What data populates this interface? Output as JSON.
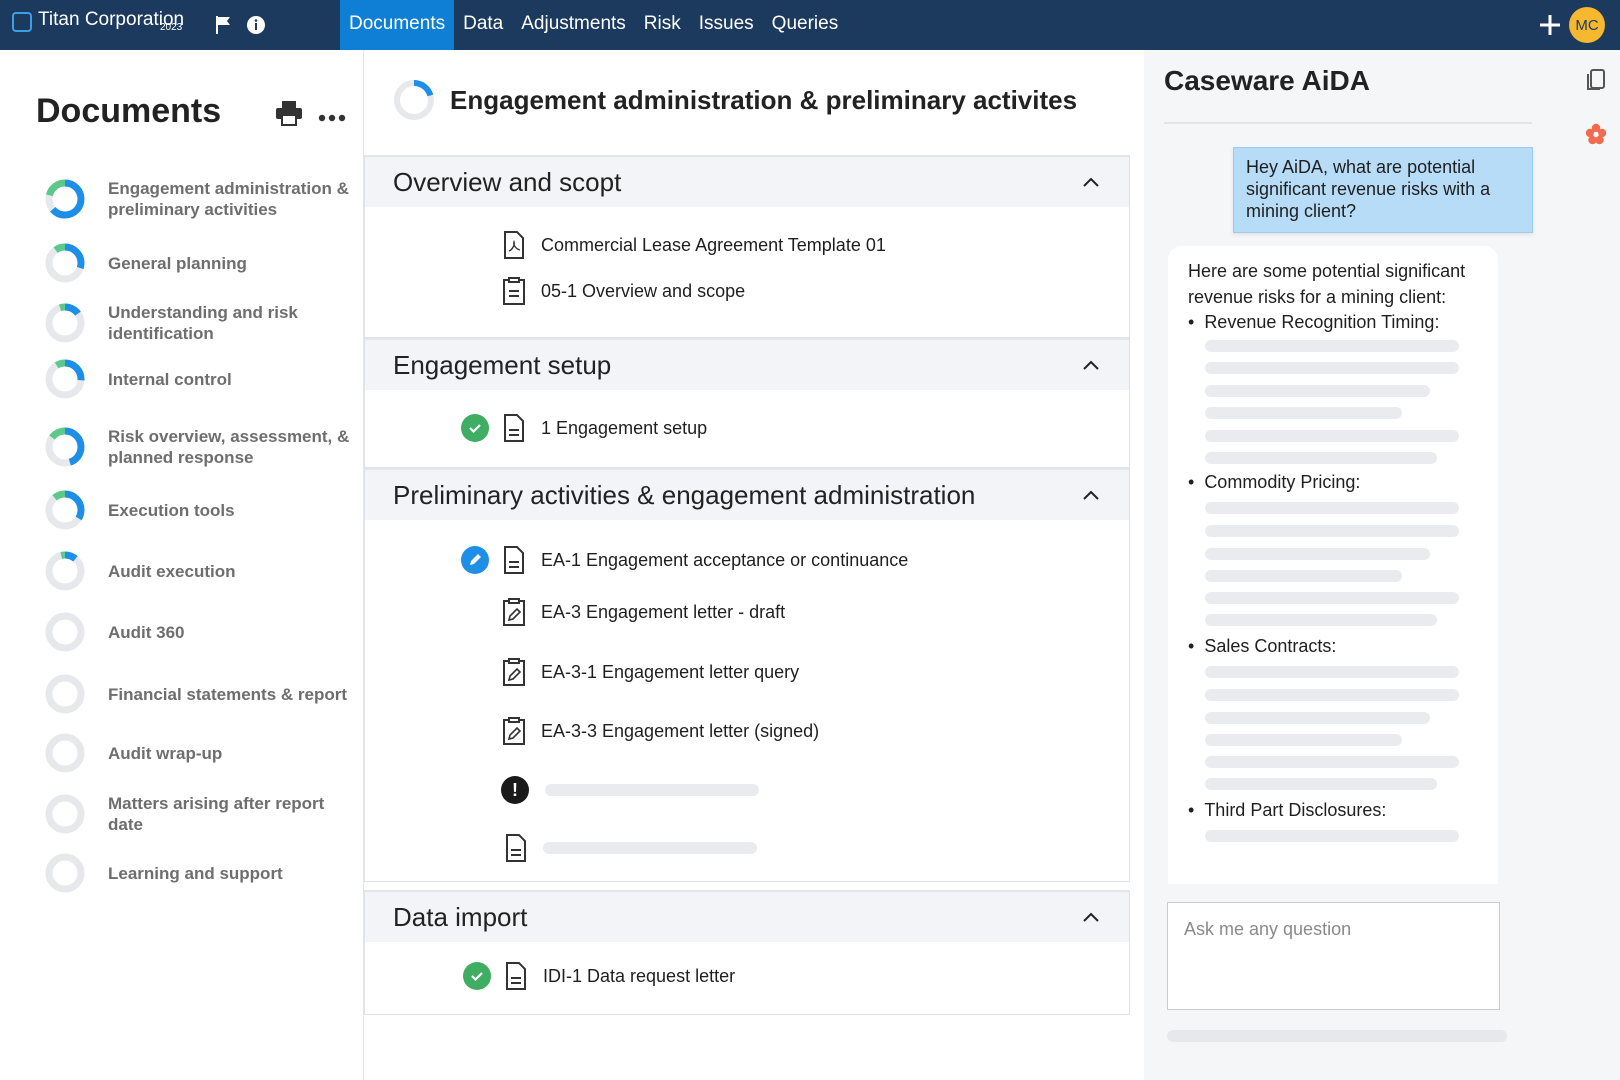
{
  "app": {
    "company": "Titan Corporation",
    "year": "2023",
    "avatar_initials": "MC",
    "brand_color": "#1b3a5e",
    "accent_color": "#0f7fd6"
  },
  "nav": {
    "tabs": [
      {
        "label": "Documents",
        "active": true
      },
      {
        "label": "Data"
      },
      {
        "label": "Adjustments"
      },
      {
        "label": "Risk"
      },
      {
        "label": "Issues"
      },
      {
        "label": "Queries"
      }
    ]
  },
  "sidebar": {
    "title": "Documents",
    "items": [
      {
        "label": "Engagement administration & preliminary activities",
        "progress": 0.85
      },
      {
        "label": "General planning",
        "progress": 0.4
      },
      {
        "label": "Understanding and risk identification",
        "progress": 0.2
      },
      {
        "label": "Internal control",
        "progress": 0.35
      },
      {
        "label": "Risk overview, assessment, & planned response",
        "progress": 0.6
      },
      {
        "label": "Execution tools",
        "progress": 0.45
      },
      {
        "label": "Audit execution",
        "progress": 0.15
      },
      {
        "label": "Audit 360",
        "progress": 0
      },
      {
        "label": "Financial statements & report",
        "progress": 0
      },
      {
        "label": "Audit wrap-up",
        "progress": 0
      },
      {
        "label": "Matters arising after report date",
        "progress": 0
      },
      {
        "label": "Learning and support",
        "progress": 0
      }
    ]
  },
  "main": {
    "title": "Engagement administration & preliminary activites",
    "sections": [
      {
        "title": "Overview and scopt",
        "docs": [
          {
            "label": "Commercial Lease Agreement Template 01",
            "icon": "pdf-icon"
          },
          {
            "label": "05-1 Overview and scope",
            "icon": "clipboard-icon"
          }
        ]
      },
      {
        "title": "Engagement setup",
        "docs": [
          {
            "label": "1 Engagement setup",
            "icon": "document-icon",
            "status": "complete"
          }
        ]
      },
      {
        "title": "Preliminary activities & engagement administration",
        "docs": [
          {
            "label": "EA-1 Engagement acceptance or continuance",
            "icon": "document-icon",
            "status": "in-progress"
          },
          {
            "label": "EA-3 Engagement letter - draft",
            "icon": "clipboard-edit-icon"
          },
          {
            "label": "EA-3-1 Engagement letter query",
            "icon": "clipboard-edit-icon"
          },
          {
            "label": "EA-3-3 Engagement letter (signed)",
            "icon": "clipboard-edit-icon"
          }
        ]
      },
      {
        "title": "Data import",
        "docs": [
          {
            "label": "IDI-1 Data request letter",
            "icon": "document-icon",
            "status": "complete"
          }
        ]
      }
    ]
  },
  "aida": {
    "title": "Caseware AiDA",
    "user_message": "Hey AiDA, what are potential significant revenue risks with a mining client?",
    "answer_intro": "Here are some potential significant revenue risks for a mining client:",
    "bullets": [
      "Revenue Recognition Timing:",
      "Commodity Pricing:",
      "Sales Contracts:",
      "Third Part Disclosures:"
    ],
    "input_placeholder": "Ask me any question"
  }
}
